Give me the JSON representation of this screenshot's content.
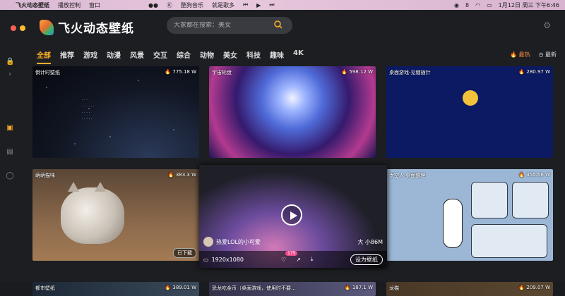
{
  "menubar": {
    "app_name": "飞火动态壁纸",
    "items": [
      "播放控制",
      "窗口"
    ],
    "now_playing_app": "酷狗音乐",
    "now_playing_title": "就是歌多",
    "wechat_count": "8",
    "datetime": "1月12日 周三 下午6:46"
  },
  "app": {
    "name": "飞火动态壁纸",
    "search_placeholder": "大家都在搜索：美女"
  },
  "categories": [
    "全部",
    "推荐",
    "游戏",
    "动漫",
    "风景",
    "交互",
    "综合",
    "动物",
    "美女",
    "科技",
    "趣味",
    "4K"
  ],
  "sort": {
    "hot": "最热",
    "new": "最新"
  },
  "cards": [
    {
      "title": "倒计时壁纸",
      "count": "775.18 W"
    },
    {
      "title": "宇宙轮盘",
      "count": "598.12 W"
    },
    {
      "title": "桌面游戏-见缝插针",
      "count": "280.97 W"
    },
    {
      "title": "萌萌猫咪",
      "count": "383.3 W",
      "badge": "已下载"
    },
    {
      "user": "热爱LOL的小可爱",
      "size": "大 小86M",
      "resolution": "1920x1080",
      "likes": "175",
      "set_label": "设为壁纸"
    },
    {
      "title": "太空人·桌面整理",
      "count": "355.56 W"
    },
    {
      "title": "都市壁纸",
      "count": "389.01 W"
    },
    {
      "title": "恐龙吃金币（桌面游戏，使用时不要...",
      "count": "187.1 W"
    },
    {
      "title": "龙猫",
      "count": "209.07 W"
    }
  ]
}
